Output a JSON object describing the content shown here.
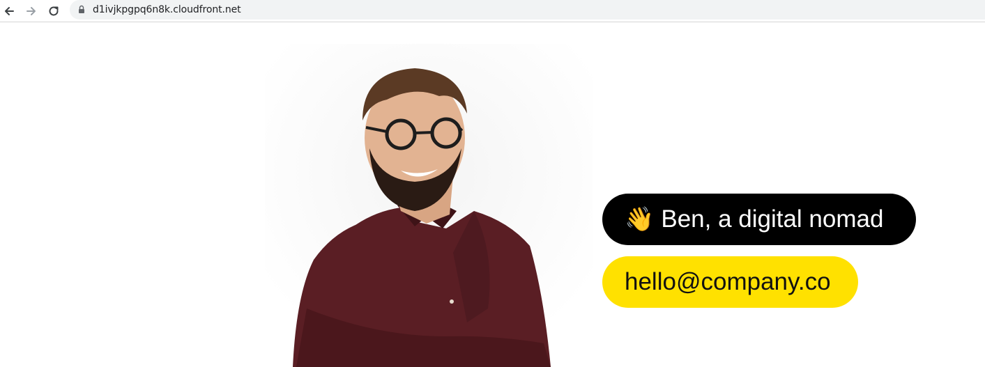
{
  "browser": {
    "url": "d1ivjkpgpq6n8k.cloudfront.net"
  },
  "hero": {
    "name_emoji": "👋",
    "name_text": "Ben, a digital nomad",
    "email": "hello@company.co"
  },
  "colors": {
    "name_pill_bg": "#000000",
    "email_pill_bg": "#ffe100",
    "shirt": "#5a1e24"
  },
  "icons": [
    "back-arrow-icon",
    "forward-arrow-icon",
    "reload-icon",
    "lock-icon"
  ]
}
